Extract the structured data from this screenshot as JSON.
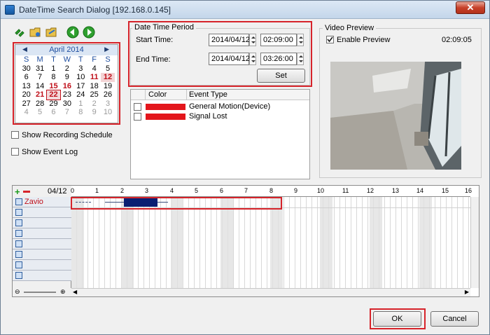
{
  "window": {
    "title": "DateTime Search Dialog [192.168.0.145]",
    "close_label": "✕"
  },
  "toolbar": {
    "icons": [
      "link-icon",
      "open-folder-icon",
      "export-icon",
      "previous-icon",
      "next-icon"
    ]
  },
  "calendar": {
    "month_label": "April 2014",
    "prev_arrow": "◀",
    "next_arrow": "▶",
    "weekdays": [
      "S",
      "M",
      "T",
      "W",
      "T",
      "F",
      "S"
    ],
    "weeks": [
      [
        "30",
        "31",
        "1",
        "2",
        "3",
        "4",
        "5"
      ],
      [
        "6",
        "7",
        "8",
        "9",
        "10",
        "11",
        "12"
      ],
      [
        "13",
        "14",
        "15",
        "16",
        "17",
        "18",
        "19"
      ],
      [
        "20",
        "21",
        "22",
        "23",
        "24",
        "25",
        "26"
      ],
      [
        "27",
        "28",
        "29",
        "30",
        "1",
        "2",
        "3"
      ],
      [
        "4",
        "5",
        "6",
        "7",
        "8",
        "9",
        "10"
      ]
    ]
  },
  "options": {
    "show_recording_schedule": "Show Recording Schedule",
    "show_event_log": "Show Event Log"
  },
  "date_time_period": {
    "group_label": "Date Time Period",
    "start_label": "Start Time:",
    "start_date": "2014/04/12",
    "start_time": "02:09:00",
    "end_label": "End Time:",
    "end_date": "2014/04/12",
    "end_time": "03:26:00",
    "set_label": "Set"
  },
  "event_table": {
    "col_color": "Color",
    "col_event_type": "Event Type",
    "rows": [
      {
        "type": "General Motion(Device)",
        "color": "#e3161c"
      },
      {
        "type": "Signal Lost",
        "color": "#e3161c"
      }
    ]
  },
  "video_preview": {
    "group_label": "Video Preview",
    "enable_label": "Enable Preview",
    "time": "02:09:05"
  },
  "timeline": {
    "date_label": "04/12",
    "camera": "Zavio",
    "hours": [
      "0",
      "1",
      "2",
      "3",
      "4",
      "5",
      "6",
      "7",
      "8",
      "9",
      "10",
      "11",
      "12",
      "13",
      "14",
      "15",
      "16"
    ]
  },
  "buttons": {
    "ok": "OK",
    "cancel": "Cancel"
  },
  "colors": {
    "highlight": "#d6232a",
    "recording": "#0a1f72",
    "accent_blue": "#1f4fa0"
  }
}
